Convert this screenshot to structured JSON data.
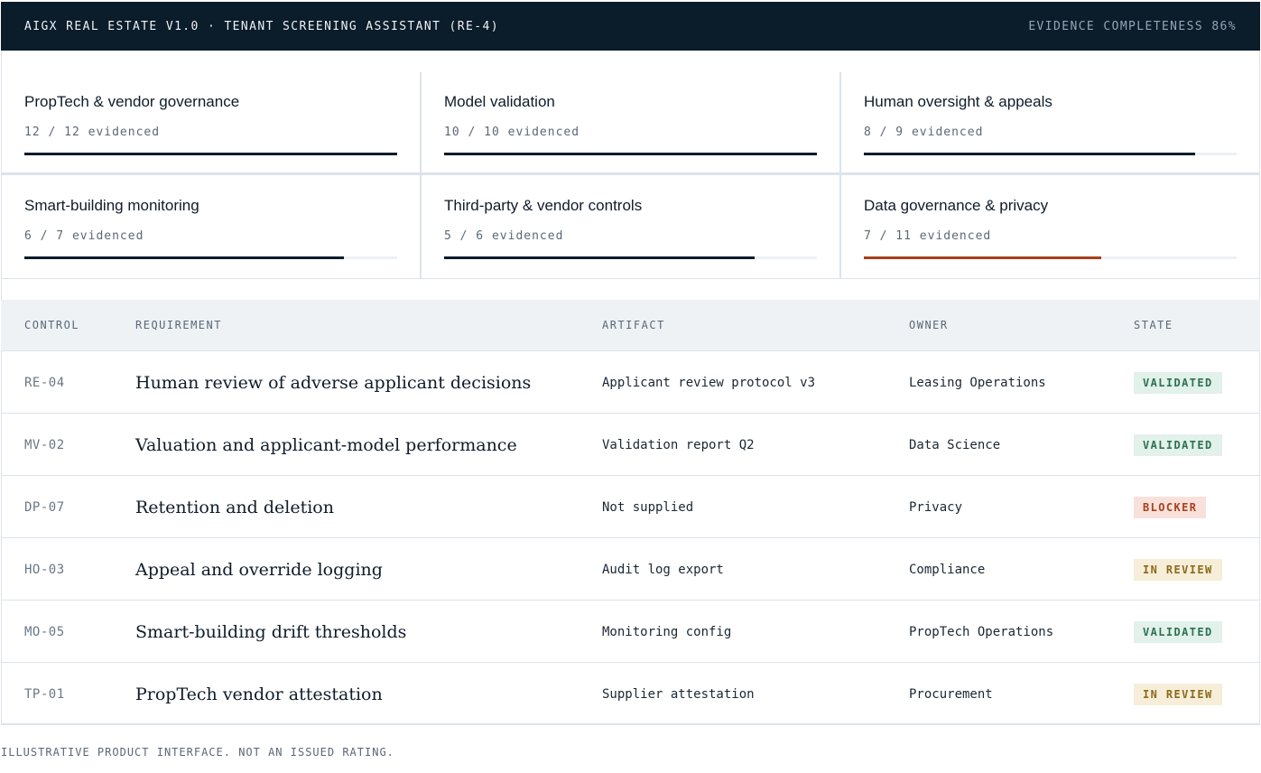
{
  "header": {
    "title": "AIGX REAL ESTATE V1.0 · TENANT SCREENING ASSISTANT (RE-4)",
    "score": "EVIDENCE COMPLETENESS 86%"
  },
  "tiles": [
    {
      "name": "PropTech & vendor governance",
      "count": "12 / 12 evidenced",
      "progress": 1.0,
      "status": "ok"
    },
    {
      "name": "Model validation",
      "count": "10 / 10 evidenced",
      "progress": 1.0,
      "status": "ok"
    },
    {
      "name": "Human oversight & appeals",
      "count": "8 / 9 evidenced",
      "progress": 0.889,
      "status": "ok"
    },
    {
      "name": "Smart-building monitoring",
      "count": "6 / 7 evidenced",
      "progress": 0.857,
      "status": "ok"
    },
    {
      "name": "Third-party & vendor controls",
      "count": "5 / 6 evidenced",
      "progress": 0.833,
      "status": "ok"
    },
    {
      "name": "Data governance & privacy",
      "count": "7 / 11 evidenced",
      "progress": 0.636,
      "status": "warn"
    }
  ],
  "table": {
    "columns": [
      "CONTROL",
      "REQUIREMENT",
      "ARTIFACT",
      "OWNER",
      "STATE"
    ],
    "rows": [
      {
        "control": "RE-04",
        "requirement": "Human review of adverse applicant decisions",
        "artifact": "Applicant review protocol v3",
        "owner": "Leasing Operations",
        "state": "VALIDATED",
        "state_kind": "validated"
      },
      {
        "control": "MV-02",
        "requirement": "Valuation and applicant-model performance",
        "artifact": "Validation report Q2",
        "owner": "Data Science",
        "state": "VALIDATED",
        "state_kind": "validated"
      },
      {
        "control": "DP-07",
        "requirement": "Retention and deletion",
        "artifact": "Not supplied",
        "owner": "Privacy",
        "state": "BLOCKER",
        "state_kind": "blocker"
      },
      {
        "control": "HO-03",
        "requirement": "Appeal and override logging",
        "artifact": "Audit log export",
        "owner": "Compliance",
        "state": "IN REVIEW",
        "state_kind": "review"
      },
      {
        "control": "MO-05",
        "requirement": "Smart-building drift thresholds",
        "artifact": "Monitoring config",
        "owner": "PropTech Operations",
        "state": "VALIDATED",
        "state_kind": "validated"
      },
      {
        "control": "TP-01",
        "requirement": "PropTech vendor attestation",
        "artifact": "Supplier attestation",
        "owner": "Procurement",
        "state": "IN REVIEW",
        "state_kind": "review"
      }
    ]
  },
  "footer": "ILLUSTRATIVE PRODUCT INTERFACE. NOT AN ISSUED RATING."
}
